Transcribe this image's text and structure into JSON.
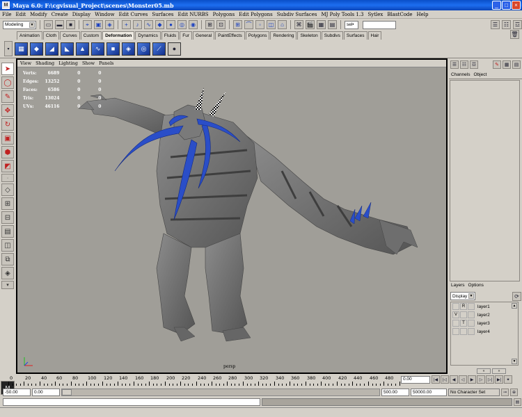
{
  "window": {
    "title": "Maya 6.0: F:\\cgvisual_Project\\scenes\\Monster05.mb"
  },
  "menubar": [
    "File",
    "Edit",
    "Modify",
    "Create",
    "Display",
    "Window",
    "Edit Curves",
    "Surfaces",
    "Edit NURBS",
    "Polygons",
    "Edit Polygons",
    "Subdiv Surfaces",
    "MJ Poly Tools 1.3",
    "Sytlex",
    "BlastCode",
    "Help"
  ],
  "status": {
    "mode": "Modeling",
    "selection_field": "sel•"
  },
  "shelf_tabs": [
    "Animation",
    "Cloth",
    "Curves",
    "Custom",
    "Deformation",
    "Dynamics",
    "Fluids",
    "Fur",
    "General",
    "PaintEffects",
    "Polygons",
    "Rendering",
    "Skeleton",
    "Subdivs",
    "Surfaces",
    "Hair"
  ],
  "shelf_active": "Deformation",
  "viewport": {
    "menu": [
      "View",
      "Shading",
      "Lighting",
      "Show",
      "Panels"
    ],
    "hud": [
      {
        "label": "Verts:",
        "value": "6689",
        "a": "0",
        "b": "0"
      },
      {
        "label": "Edges:",
        "value": "13252",
        "a": "0",
        "b": "0"
      },
      {
        "label": "Faces:",
        "value": "6586",
        "a": "0",
        "b": "0"
      },
      {
        "label": "Tris:",
        "value": "13024",
        "a": "0",
        "b": "0"
      },
      {
        "label": "UVs:",
        "value": "46116",
        "a": "0",
        "b": "0"
      }
    ],
    "camera": "persp"
  },
  "channels": {
    "tabs": [
      "Channels",
      "Object"
    ]
  },
  "layers": {
    "tabs": [
      "Layers",
      "Options"
    ],
    "display_select": "Display",
    "list": [
      {
        "name": "layer1",
        "v": "",
        "r": "R"
      },
      {
        "name": "layer2",
        "v": "V",
        "r": ""
      },
      {
        "name": "layer3",
        "v": "",
        "r": "T"
      },
      {
        "name": "layer4",
        "v": "",
        "r": ""
      }
    ]
  },
  "timeline": {
    "ticks": [
      "0",
      "20",
      "40",
      "60",
      "80",
      "100",
      "120",
      "140",
      "160",
      "180",
      "200",
      "220",
      "240",
      "260",
      "280",
      "300",
      "320",
      "340",
      "360",
      "380",
      "400",
      "420",
      "440",
      "460",
      "480",
      "5"
    ],
    "current_frame": "0.00"
  },
  "range": {
    "start": "-50.00",
    "playback_start": "0.00",
    "playback_end": "500.00",
    "end": "50000.00",
    "character_set": "No Character Set"
  }
}
